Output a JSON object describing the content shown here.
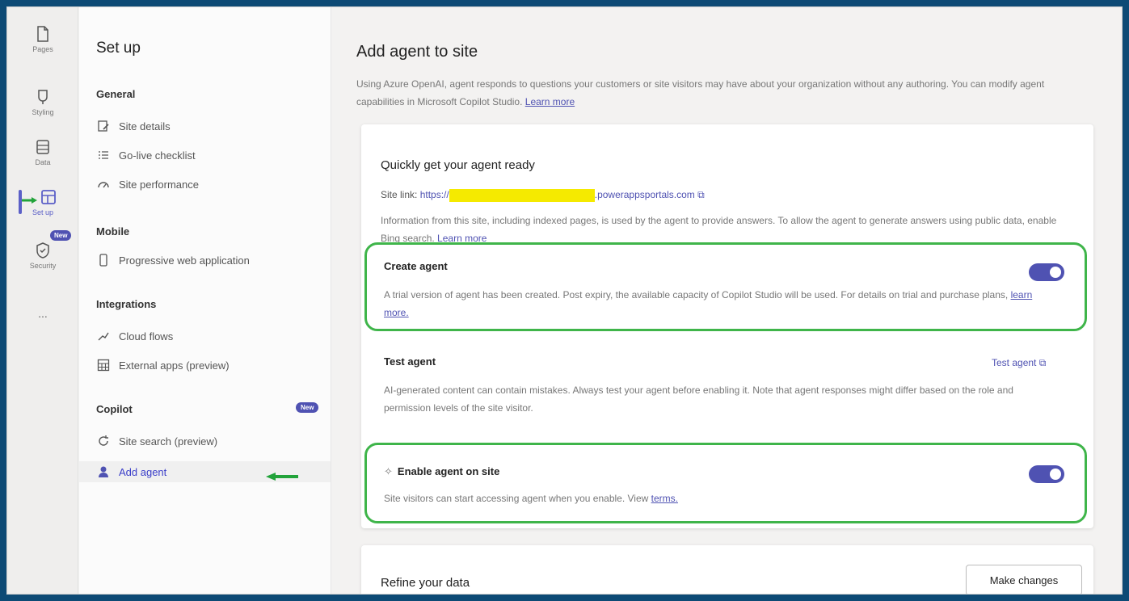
{
  "rail": {
    "items": [
      {
        "label": "Pages",
        "icon": "page-icon"
      },
      {
        "label": "Styling",
        "icon": "styling-icon"
      },
      {
        "label": "Data",
        "icon": "data-icon"
      },
      {
        "label": "Set up",
        "icon": "setup-icon"
      },
      {
        "label": "Security",
        "icon": "security-icon"
      },
      {
        "label": "...",
        "icon": "more-icon"
      }
    ],
    "new_badge": "New"
  },
  "nav": {
    "title": "Set up",
    "general": {
      "label": "General",
      "items": [
        "Site details",
        "Go-live checklist",
        "Site performance"
      ]
    },
    "mobile": {
      "label": "Mobile",
      "items": [
        "Progressive web application"
      ]
    },
    "integrations": {
      "label": "Integrations",
      "items": [
        "Cloud flows",
        "External apps (preview)"
      ]
    },
    "copilot": {
      "label": "Copilot",
      "badge": "New",
      "items": [
        "Site search (preview)",
        "Add agent"
      ]
    }
  },
  "main": {
    "title": "Add agent to site",
    "description": "Using Azure OpenAI, agent responds to questions your customers or site visitors may have about your organization without any authoring. You can modify agent capabilities in Microsoft Copilot Studio.",
    "learn_more": "Learn more",
    "card": {
      "title": "Quickly get your agent ready",
      "site_link_label": "Site link:",
      "site_link_prefix": "https://",
      "site_link_suffix": ".powerappsportals.com",
      "info": "Information from this site, including indexed pages, is used by the agent to provide answers. To allow the agent to generate answers using public data, enable Bing search.",
      "info_link": "Learn more",
      "create_agent": {
        "title": "Create agent",
        "text": "A trial version of agent has been created. Post expiry, the available capacity of Copilot Studio will be used. For details on trial and purchase plans,",
        "link": "learn more.",
        "enabled": true
      },
      "test_agent": {
        "title": "Test agent",
        "link": "Test agent",
        "text": "AI-generated content can contain mistakes. Always test your agent before enabling it. Note that agent responses might differ based on the role and permission levels of the site visitor."
      },
      "enable_agent": {
        "title": "Enable agent on site",
        "text": "Site visitors can start accessing agent when you enable. View",
        "link": "terms.",
        "enabled": true
      }
    },
    "refine": {
      "title": "Refine your data",
      "button": "Make changes"
    }
  }
}
